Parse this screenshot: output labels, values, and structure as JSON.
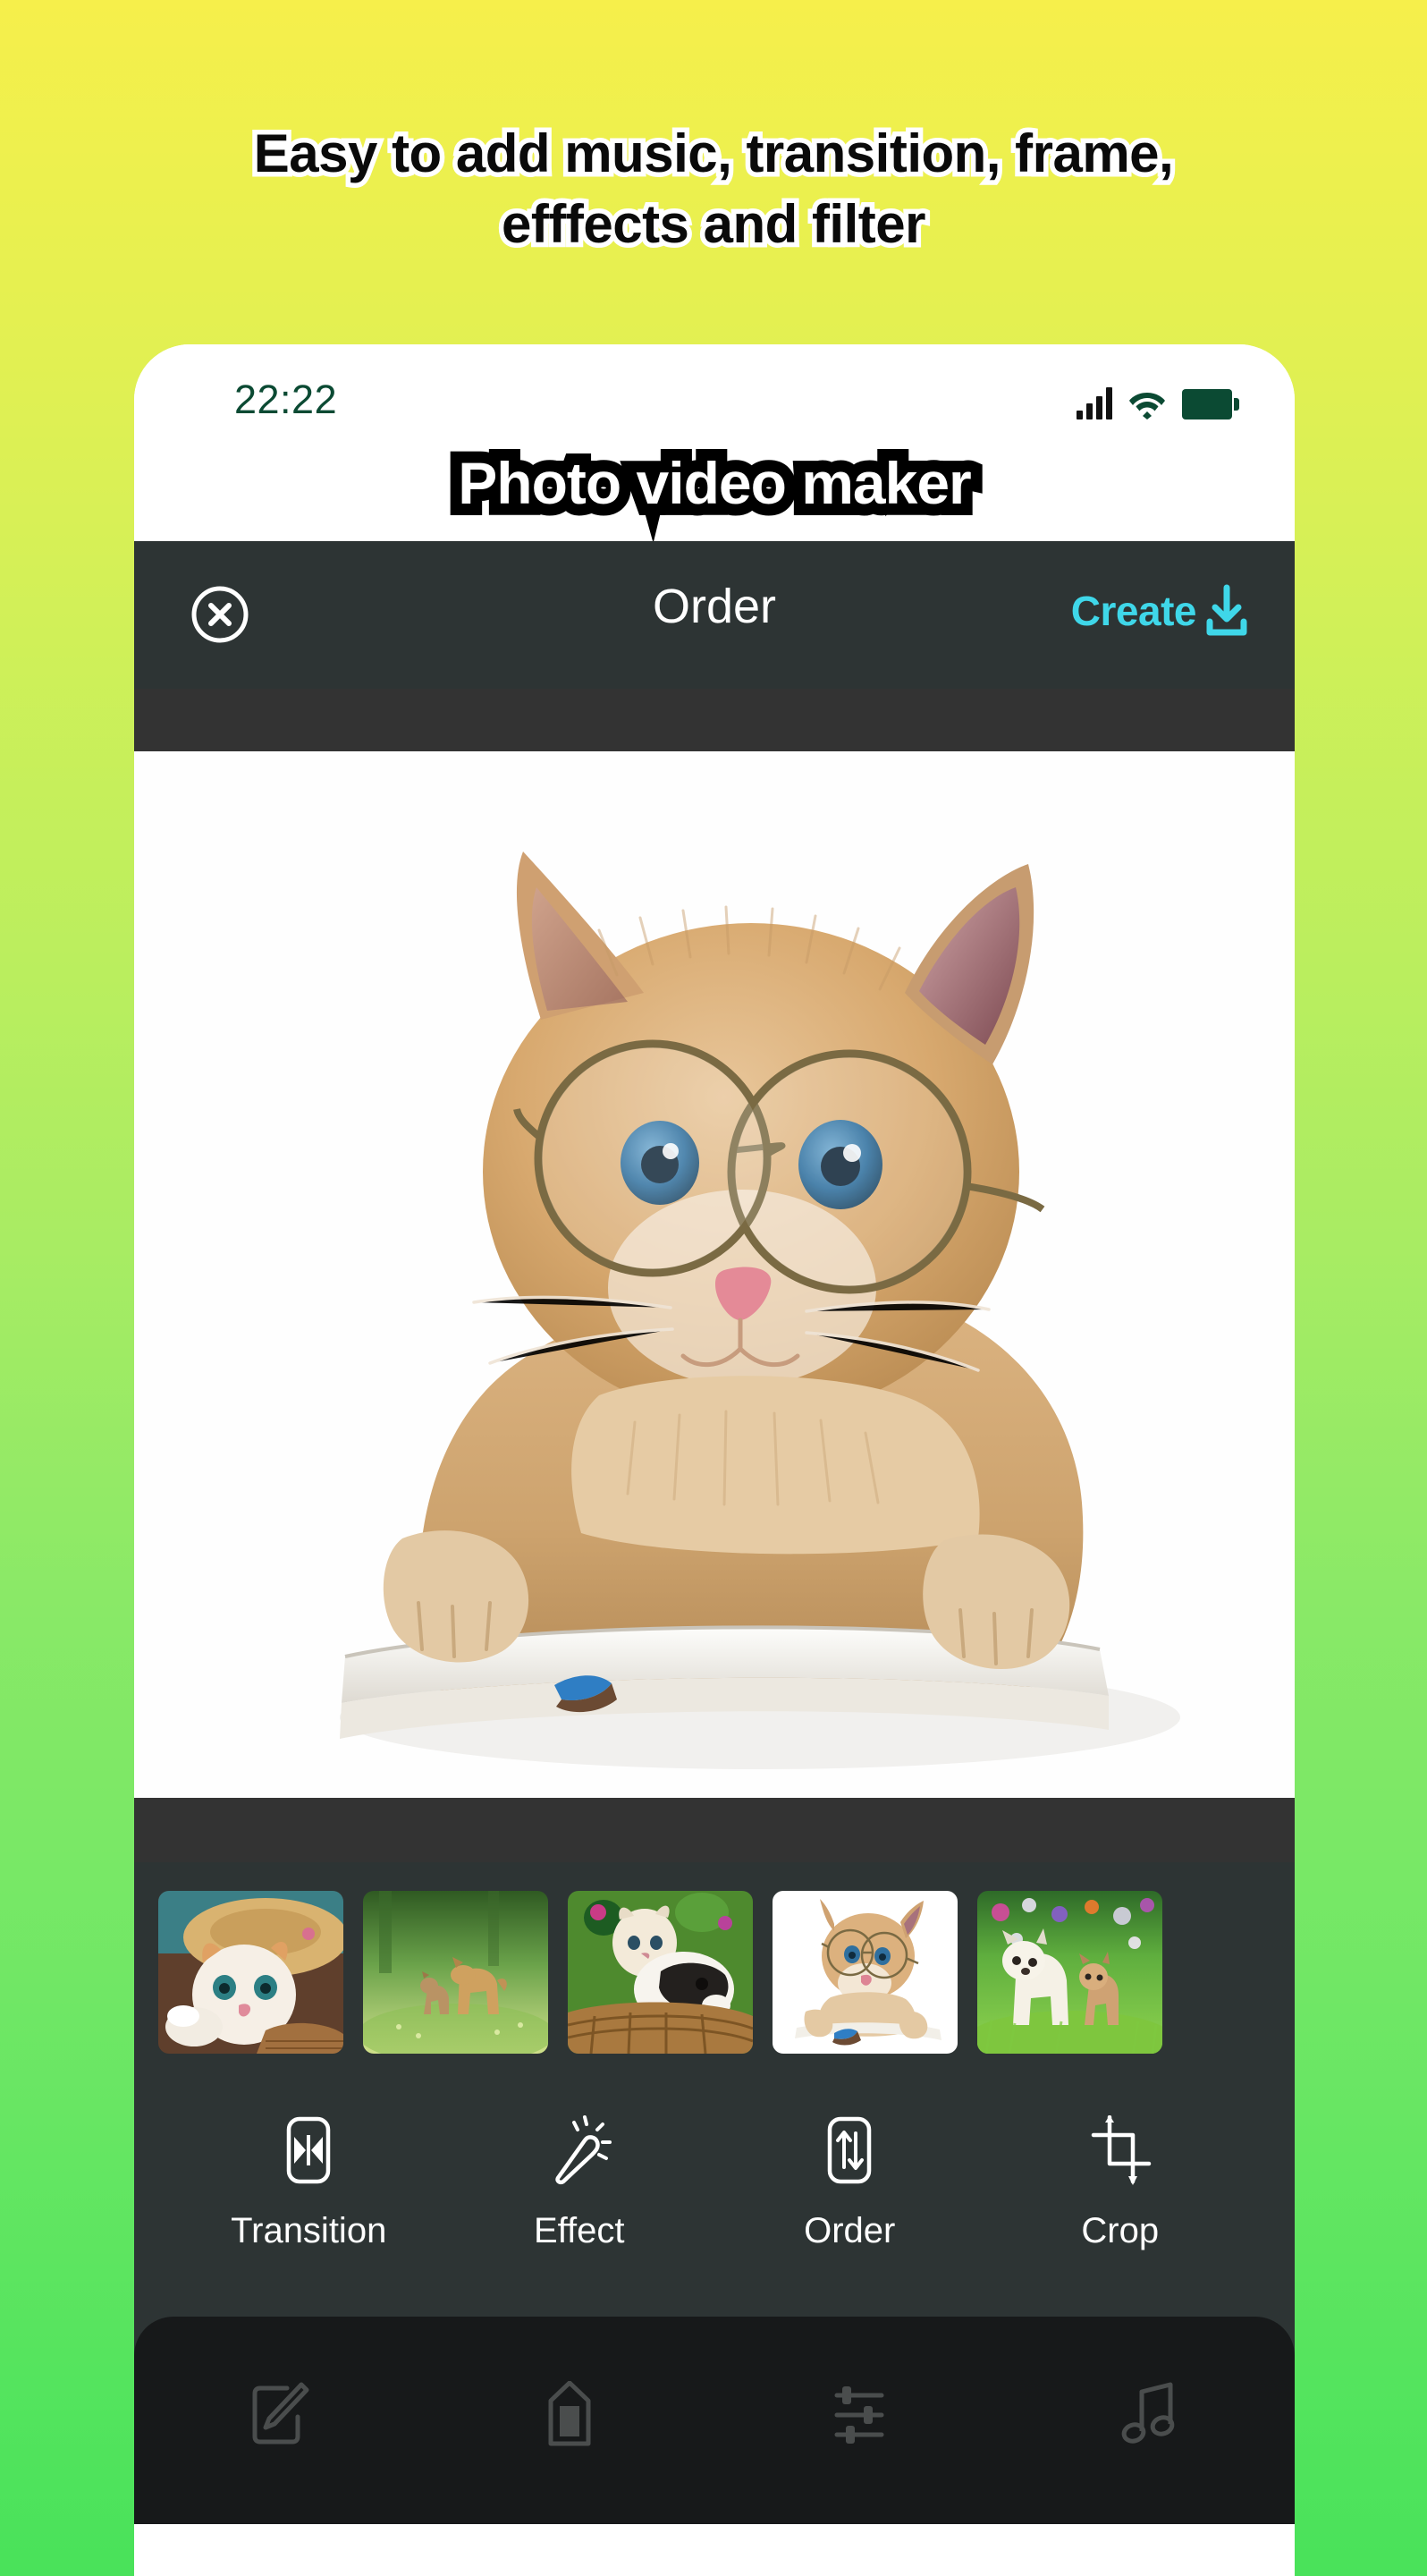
{
  "promo": {
    "headline": "Easy to add music, transition, frame,\nefffects and filter",
    "background_top_color": "#f6ef4b",
    "background_bottom_color": "#49e25a"
  },
  "phone": {
    "statusbar": {
      "time": "22:22",
      "time_color": "#0b4a33",
      "icons": [
        "signal-bars-icon",
        "wifi-icon",
        "battery-icon"
      ]
    },
    "app_title": "Photo video maker",
    "toolbar": {
      "close_icon": "close-circle-icon",
      "title": "Order",
      "create_label": "Create",
      "create_icon": "download-icon",
      "create_color": "#3fd7e9",
      "background_color": "#2d3434"
    },
    "preview": {
      "alt": "orange tabby kitten wearing round glasses resting on an open book",
      "background_color": "#ffffff"
    },
    "thumbnails": [
      {
        "alt": "ginger and white kitten wearing a straw hat in a basket with lilies",
        "selected": false
      },
      {
        "alt": "puppy and kitten standing in a sunlit green meadow",
        "selected": false
      },
      {
        "alt": "fluffy cream kitten with black and white puppy in a wicker basket",
        "selected": false
      },
      {
        "alt": "orange tabby kitten with round glasses on a book",
        "selected": true
      },
      {
        "alt": "white puppy and tabby kitten in spring grass",
        "selected": false
      }
    ],
    "tools": [
      {
        "label": "Transition",
        "icon": "transition-icon"
      },
      {
        "label": "Effect",
        "icon": "magic-wand-icon"
      },
      {
        "label": "Order",
        "icon": "reorder-icon"
      },
      {
        "label": "Crop",
        "icon": "crop-icon"
      }
    ],
    "bottom_nav": [
      {
        "icon": "edit-icon"
      },
      {
        "icon": "frame-icon"
      },
      {
        "icon": "adjust-sliders-icon"
      },
      {
        "icon": "music-note-icon"
      }
    ]
  }
}
